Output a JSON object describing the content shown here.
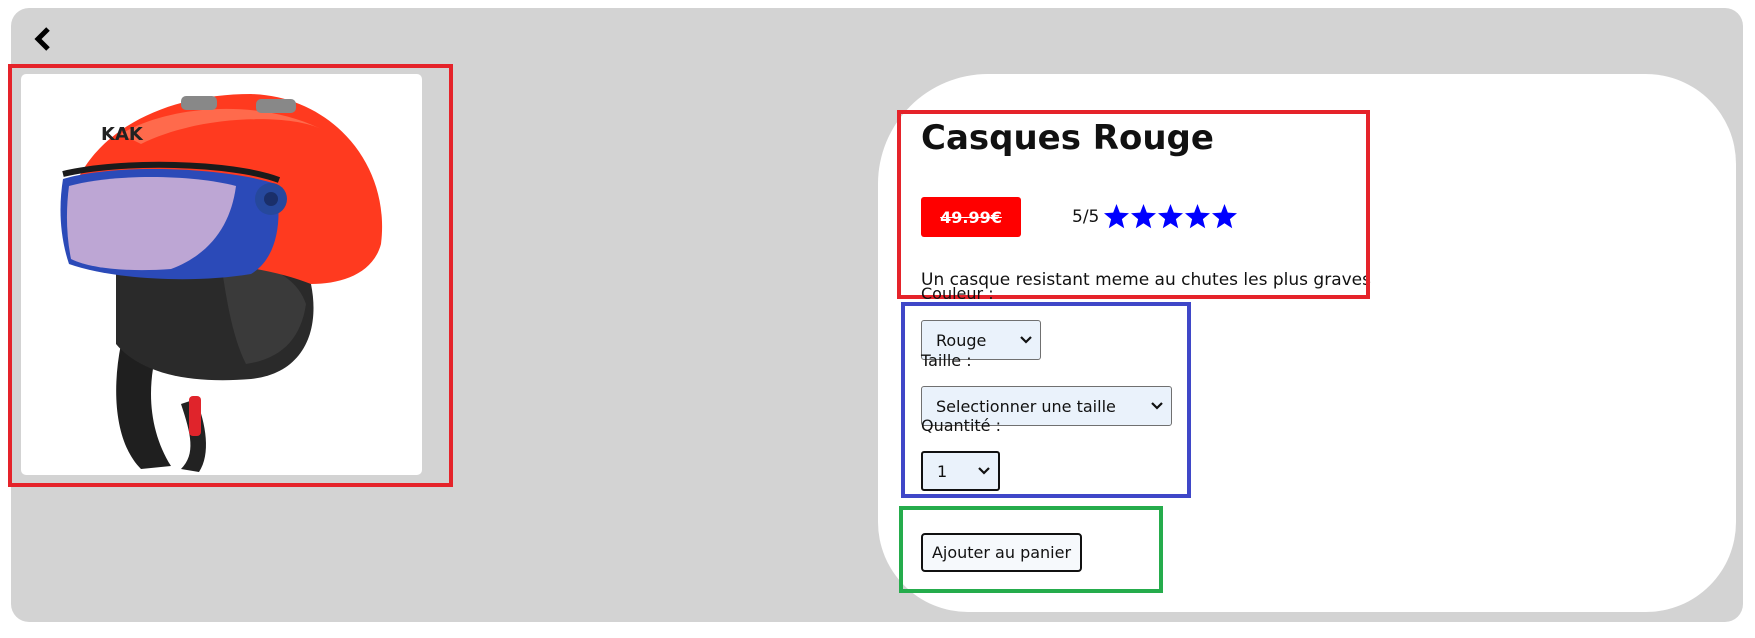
{
  "nav": {
    "back_icon": "chevron-left-icon"
  },
  "product": {
    "title": "Casques Rouge",
    "price": "49.99€",
    "rating_text": "5/5",
    "rating_value": 5,
    "rating_max": 5,
    "description": "Un casque resistant meme au chutes les plus graves",
    "image_icon": "red-ski-helmet-with-visor"
  },
  "options": {
    "color_label": "Couleur :",
    "color_value": "Rouge",
    "size_label": "Taille :",
    "size_value": "Selectionner une taille",
    "quantity_label": "Quantité :",
    "quantity_value": "1"
  },
  "actions": {
    "add_to_cart": "Ajouter au panier"
  },
  "colors": {
    "background_panel": "#d3d3d3",
    "price_badge": "#ff0000",
    "stars": "#0000ff",
    "outline_red": "#e5232a",
    "outline_blue": "#3f47c8",
    "outline_green": "#25ac4c"
  }
}
